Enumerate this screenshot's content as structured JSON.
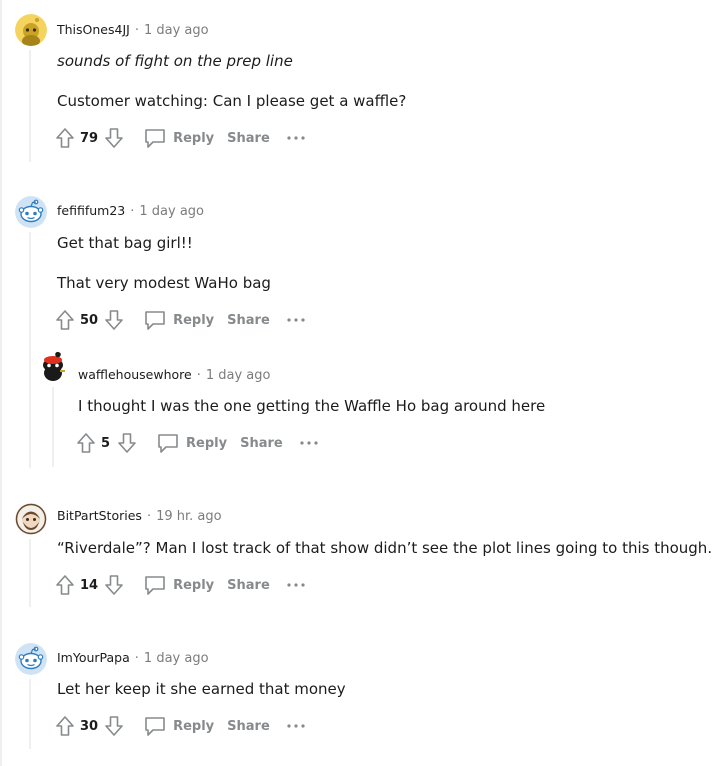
{
  "comments": [
    {
      "username": "ThisOnes4JJ",
      "time": "1 day ago",
      "lines": [
        "sounds of fight on the prep line",
        "Customer watching: Can I please get a waffle?"
      ],
      "score": "79",
      "reply_label": "Reply",
      "share_label": "Share",
      "avatar_icon": "yellow-snoo-avatar-icon"
    },
    {
      "username": "fefififum23",
      "time": "1 day ago",
      "lines": [
        "Get that bag girl!!",
        "That very modest WaHo bag"
      ],
      "score": "50",
      "reply_label": "Reply",
      "share_label": "Share",
      "avatar_icon": "blue-snoo-avatar-icon"
    },
    {
      "username": "wafflehousewhore",
      "time": "1 day ago",
      "lines": [
        "I thought I was the one getting the Waffle Ho bag around here"
      ],
      "score": "5",
      "reply_label": "Reply",
      "share_label": "Share",
      "avatar_icon": "black-snoo-red-hat-avatar-icon"
    },
    {
      "username": "BitPartStories",
      "time": "19 hr. ago",
      "lines": [
        "“Riverdale”? Man I lost track of that show didn’t see the plot lines going to this though."
      ],
      "score": "14",
      "reply_label": "Reply",
      "share_label": "Share",
      "avatar_icon": "bearded-snoo-avatar-icon"
    },
    {
      "username": "ImYourPapa",
      "time": "1 day ago",
      "lines": [
        "Let her keep it she earned that money"
      ],
      "score": "30",
      "reply_label": "Reply",
      "share_label": "Share",
      "avatar_icon": "blue-snoo-avatar-icon"
    }
  ],
  "meta_separator": "·",
  "colors": {
    "text": "#1c1c1c",
    "meta": "#7c7c7c",
    "action": "#878a8c",
    "thread_line": "#edeff1",
    "snoo_blue": "#cfe3f4"
  }
}
